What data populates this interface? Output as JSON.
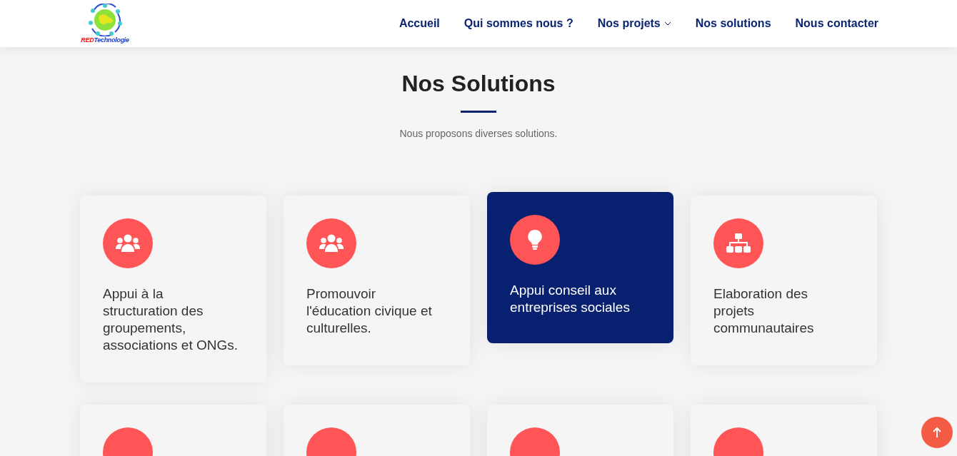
{
  "header": {
    "logo": {
      "red": "RED",
      "name": "Technologie"
    },
    "nav": [
      {
        "label": "Accueil",
        "dropdown": false
      },
      {
        "label": "Qui sommes nous ?",
        "dropdown": false
      },
      {
        "label": "Nos projets",
        "dropdown": true
      },
      {
        "label": "Nos solutions",
        "dropdown": false
      },
      {
        "label": "Nous contacter",
        "dropdown": false
      }
    ]
  },
  "section": {
    "title": "Nos Solutions",
    "subtitle": "Nous proposons diverses solutions."
  },
  "cards": [
    {
      "kind": "people",
      "text": "Appui à la structuration des groupements, associations et ONGs.",
      "highlighted": false
    },
    {
      "kind": "people",
      "text": "Promouvoir l'éducation civique et culturelles.",
      "highlighted": false
    },
    {
      "kind": "bulb",
      "text": "Appui conseil aux entreprises sociales",
      "highlighted": true
    },
    {
      "kind": "sitemap",
      "text": "Elaboration des projets communautaires",
      "highlighted": false
    },
    {
      "highlighted": false
    },
    {
      "highlighted": false
    },
    {
      "highlighted": false
    },
    {
      "highlighted": false
    }
  ]
}
